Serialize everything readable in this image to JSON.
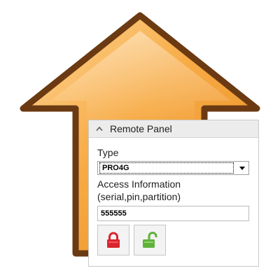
{
  "graphic": {
    "icon": "upload-arrow-icon",
    "fill_color": "#f6a940",
    "outline_color": "#6b3a12"
  },
  "panel": {
    "title": "Remote Panel",
    "header_icon": "chevron-up-icon",
    "type_label": "Type",
    "type_value": "PRO4G",
    "access_label_line1": "Access Information",
    "access_label_line2": "(serial,pin,partition)",
    "access_value": "555555",
    "buttons": [
      {
        "icon": "lock-icon",
        "color": "#d9252f"
      },
      {
        "icon": "unlock-icon",
        "color": "#5db33a"
      }
    ]
  }
}
